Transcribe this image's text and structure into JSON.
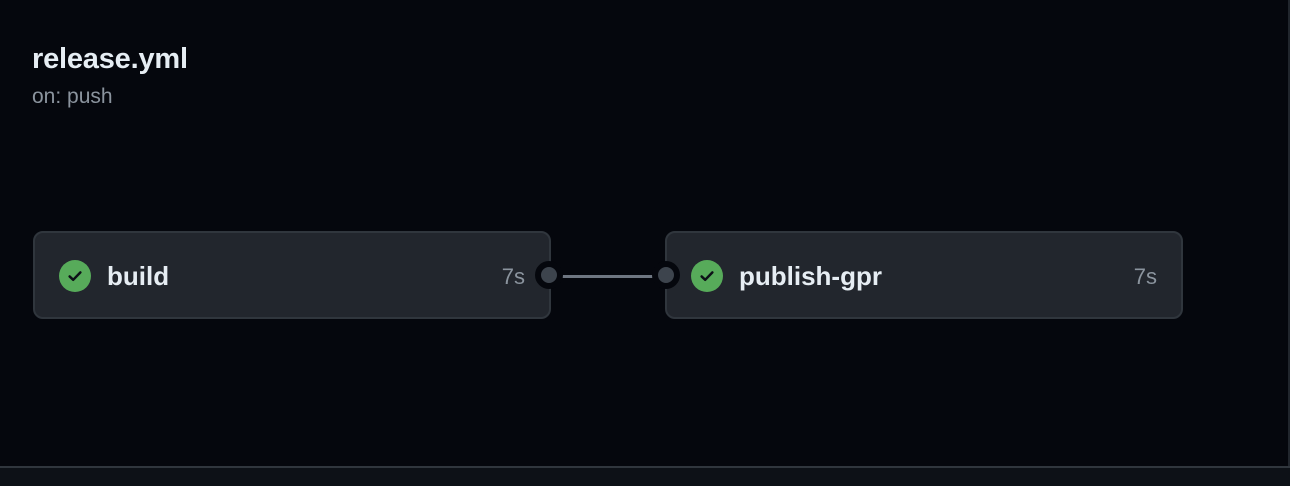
{
  "workflow": {
    "title": "release.yml",
    "trigger": "on: push"
  },
  "jobs": [
    {
      "name": "build",
      "duration": "7s",
      "status": "success",
      "icon": "check-circle-icon"
    },
    {
      "name": "publish-gpr",
      "duration": "7s",
      "status": "success",
      "icon": "check-circle-icon"
    }
  ],
  "colors": {
    "background": "#05070d",
    "card": "#22262d",
    "card_border": "#30363d",
    "success": "#57ab5a",
    "text_primary": "#e6edf3",
    "text_muted": "#8b949e"
  }
}
